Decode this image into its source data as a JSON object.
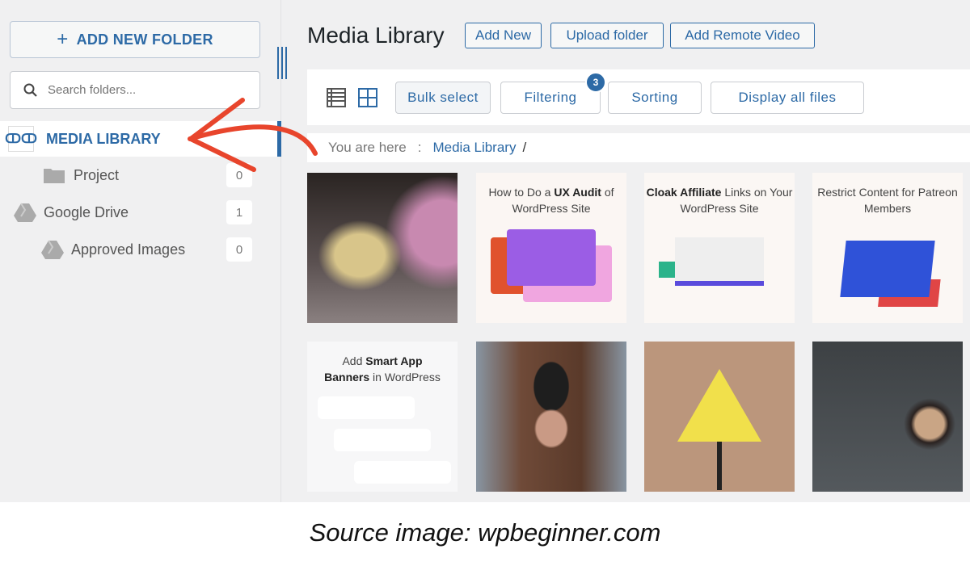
{
  "sidebar": {
    "add_folder_label": "ADD NEW FOLDER",
    "search_placeholder": "Search folders...",
    "items": [
      {
        "label": "MEDIA LIBRARY",
        "icon": "media-library-logo-icon",
        "active": true
      },
      {
        "label": "Project",
        "count": "0",
        "icon": "folder-icon"
      },
      {
        "label": "Google Drive",
        "count": "1",
        "icon": "google-drive-icon"
      },
      {
        "label": "Approved Images",
        "count": "0",
        "icon": "google-drive-icon"
      }
    ]
  },
  "header": {
    "title": "Media Library",
    "buttons": [
      "Add New",
      "Upload folder",
      "Add Remote Video"
    ]
  },
  "toolbar": {
    "bulk": "Bulk select",
    "filtering": "Filtering",
    "filter_badge": "3",
    "sorting": "Sorting",
    "display": "Display all files"
  },
  "breadcrumb": {
    "prefix": "You are here",
    "sep": ":",
    "current": "Media Library",
    "trail": "/"
  },
  "tiles": [
    {
      "type": "photo",
      "subject": "rabbit"
    },
    {
      "type": "graphic",
      "pre": "How to Do a ",
      "bold": "UX Audit",
      "post": " of WordPress Site"
    },
    {
      "type": "graphic",
      "pre": "",
      "bold": "Cloak Affiliate",
      "post": " Links on Your WordPress Site"
    },
    {
      "type": "graphic",
      "pre": "Restrict Content for Patreon Members",
      "bold": "",
      "post": ""
    },
    {
      "type": "graphic",
      "pre": "Add ",
      "bold": "Smart App Banners",
      "post": " in WordPress"
    },
    {
      "type": "photo",
      "subject": "woman in beanie"
    },
    {
      "type": "graphic",
      "subject": "warning sign"
    },
    {
      "type": "photo",
      "subject": "coffee cup"
    }
  ],
  "caption": "Source image: wpbeginner.com",
  "colors": {
    "accent": "#2d6aa6",
    "annotation_arrow": "#e8452c",
    "background": "#f0f0f1"
  }
}
